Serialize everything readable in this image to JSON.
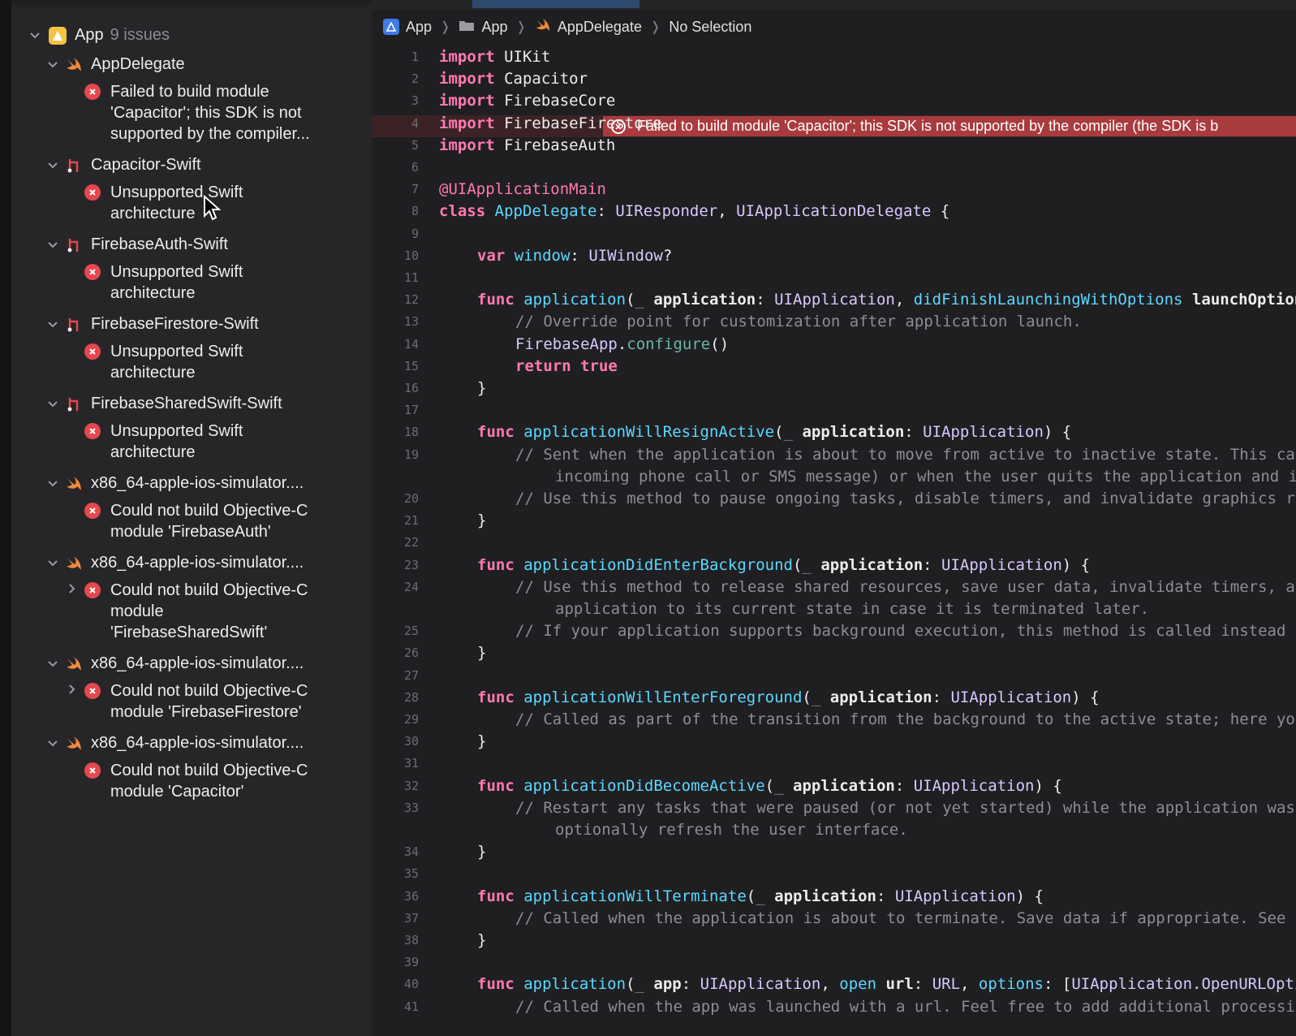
{
  "issues": {
    "root": {
      "label": "App",
      "count": "9 issues"
    },
    "groups": [
      {
        "name": "AppDelegate",
        "icon": "swift-icon",
        "issues": [
          {
            "lines": [
              "Failed to build module",
              "'Capacitor'; this SDK is not",
              "supported by the compiler..."
            ]
          }
        ]
      },
      {
        "name": "Capacitor-Swift",
        "icon": "target-icon",
        "issues": [
          {
            "lines": [
              "Unsupported Swift",
              "architecture"
            ]
          }
        ]
      },
      {
        "name": "FirebaseAuth-Swift",
        "icon": "target-icon",
        "issues": [
          {
            "lines": [
              "Unsupported Swift",
              "architecture"
            ]
          }
        ]
      },
      {
        "name": "FirebaseFirestore-Swift",
        "icon": "target-icon",
        "issues": [
          {
            "lines": [
              "Unsupported Swift",
              "architecture"
            ]
          }
        ]
      },
      {
        "name": "FirebaseSharedSwift-Swift",
        "icon": "target-icon",
        "issues": [
          {
            "lines": [
              "Unsupported Swift",
              "architecture"
            ]
          }
        ]
      },
      {
        "name": "x86_64-apple-ios-simulator....",
        "icon": "swift-icon",
        "issues": [
          {
            "lines": [
              "Could not build Objective-C",
              "module 'FirebaseAuth'"
            ]
          }
        ]
      },
      {
        "name": "x86_64-apple-ios-simulator....",
        "icon": "swift-icon",
        "issues": [
          {
            "lines": [
              "Could not build Objective-C",
              "module",
              "'FirebaseSharedSwift'"
            ]
          }
        ]
      },
      {
        "name": "x86_64-apple-ios-simulator....",
        "icon": "swift-icon",
        "issues": [
          {
            "lines": [
              "Could not build Objective-C",
              "module 'FirebaseFirestore'"
            ]
          }
        ]
      },
      {
        "name": "x86_64-apple-ios-simulator....",
        "icon": "swift-icon",
        "issues": [
          {
            "lines": [
              "Could not build Objective-C",
              "module 'Capacitor'"
            ]
          }
        ]
      }
    ]
  },
  "breadcrumb": [
    {
      "label": "App",
      "icon": "project-icon"
    },
    {
      "label": "App",
      "icon": "folder-icon"
    },
    {
      "label": "AppDelegate",
      "icon": "swift-icon"
    },
    {
      "label": "No Selection",
      "icon": ""
    }
  ],
  "editor": {
    "error_message": "Failed to build module 'Capacitor'; this SDK is not supported by the compiler (the SDK is b",
    "lines": [
      "1",
      "2",
      "3",
      "4",
      "5",
      "6",
      "7",
      "8",
      "9",
      "10",
      "11",
      "12",
      "13",
      "14",
      "15",
      "16",
      "17",
      "18",
      "19",
      "20",
      "21",
      "22",
      "23",
      "24",
      "25",
      "26",
      "27",
      "28",
      "29",
      "30",
      "31",
      "32",
      "33",
      "34",
      "35",
      "36",
      "37",
      "38",
      "39",
      "40",
      "41"
    ]
  },
  "colors": {
    "error_red": "#e5484d",
    "keyword": "#ff7ab2",
    "type": "#d9c8ff",
    "comment": "#8d8d93"
  }
}
